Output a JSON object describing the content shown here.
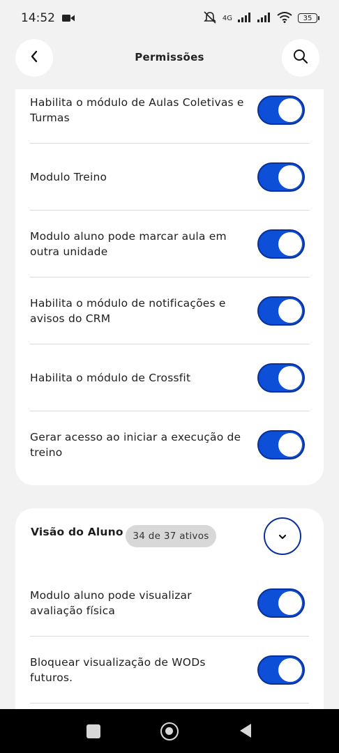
{
  "status_bar": {
    "time": "14:52",
    "network": "4G",
    "battery": "35",
    "icons": [
      "video-camera-icon",
      "muted-bell-icon",
      "signal-icon",
      "signal-icon",
      "wifi-icon",
      "battery-icon"
    ]
  },
  "header": {
    "title": "Permissões",
    "back_icon": "chevron-left-icon",
    "search_icon": "search-icon"
  },
  "section_1": {
    "items": [
      {
        "label": "Habilita o módulo de Aulas Coletivas e Turmas",
        "enabled": true
      },
      {
        "label": "Modulo Treino",
        "enabled": true
      },
      {
        "label": "Modulo aluno pode marcar aula em outra unidade",
        "enabled": true
      },
      {
        "label": "Habilita o módulo de notificações e avisos do CRM",
        "enabled": true
      },
      {
        "label": "Habilita o módulo de Crossfit",
        "enabled": true
      },
      {
        "label": "Gerar acesso ao iniciar a execução de treino",
        "enabled": true
      }
    ]
  },
  "section_2": {
    "title": "Visão do Aluno",
    "badge": "34 de 37 ativos",
    "collapse_icon": "chevron-down-icon",
    "items": [
      {
        "label": "Modulo aluno pode visualizar avaliação física",
        "enabled": true
      },
      {
        "label": "Bloquear visualização de WODs futuros.",
        "enabled": true
      }
    ]
  },
  "nav_bar": {
    "icons": [
      "recents-square-icon",
      "home-circle-icon",
      "back-triangle-icon"
    ]
  },
  "colors": {
    "accent": "#0d4fd6",
    "accent_border": "#0a2f9a",
    "background": "#f2f2f2",
    "card": "#ffffff",
    "badge": "#d8d8d8"
  }
}
